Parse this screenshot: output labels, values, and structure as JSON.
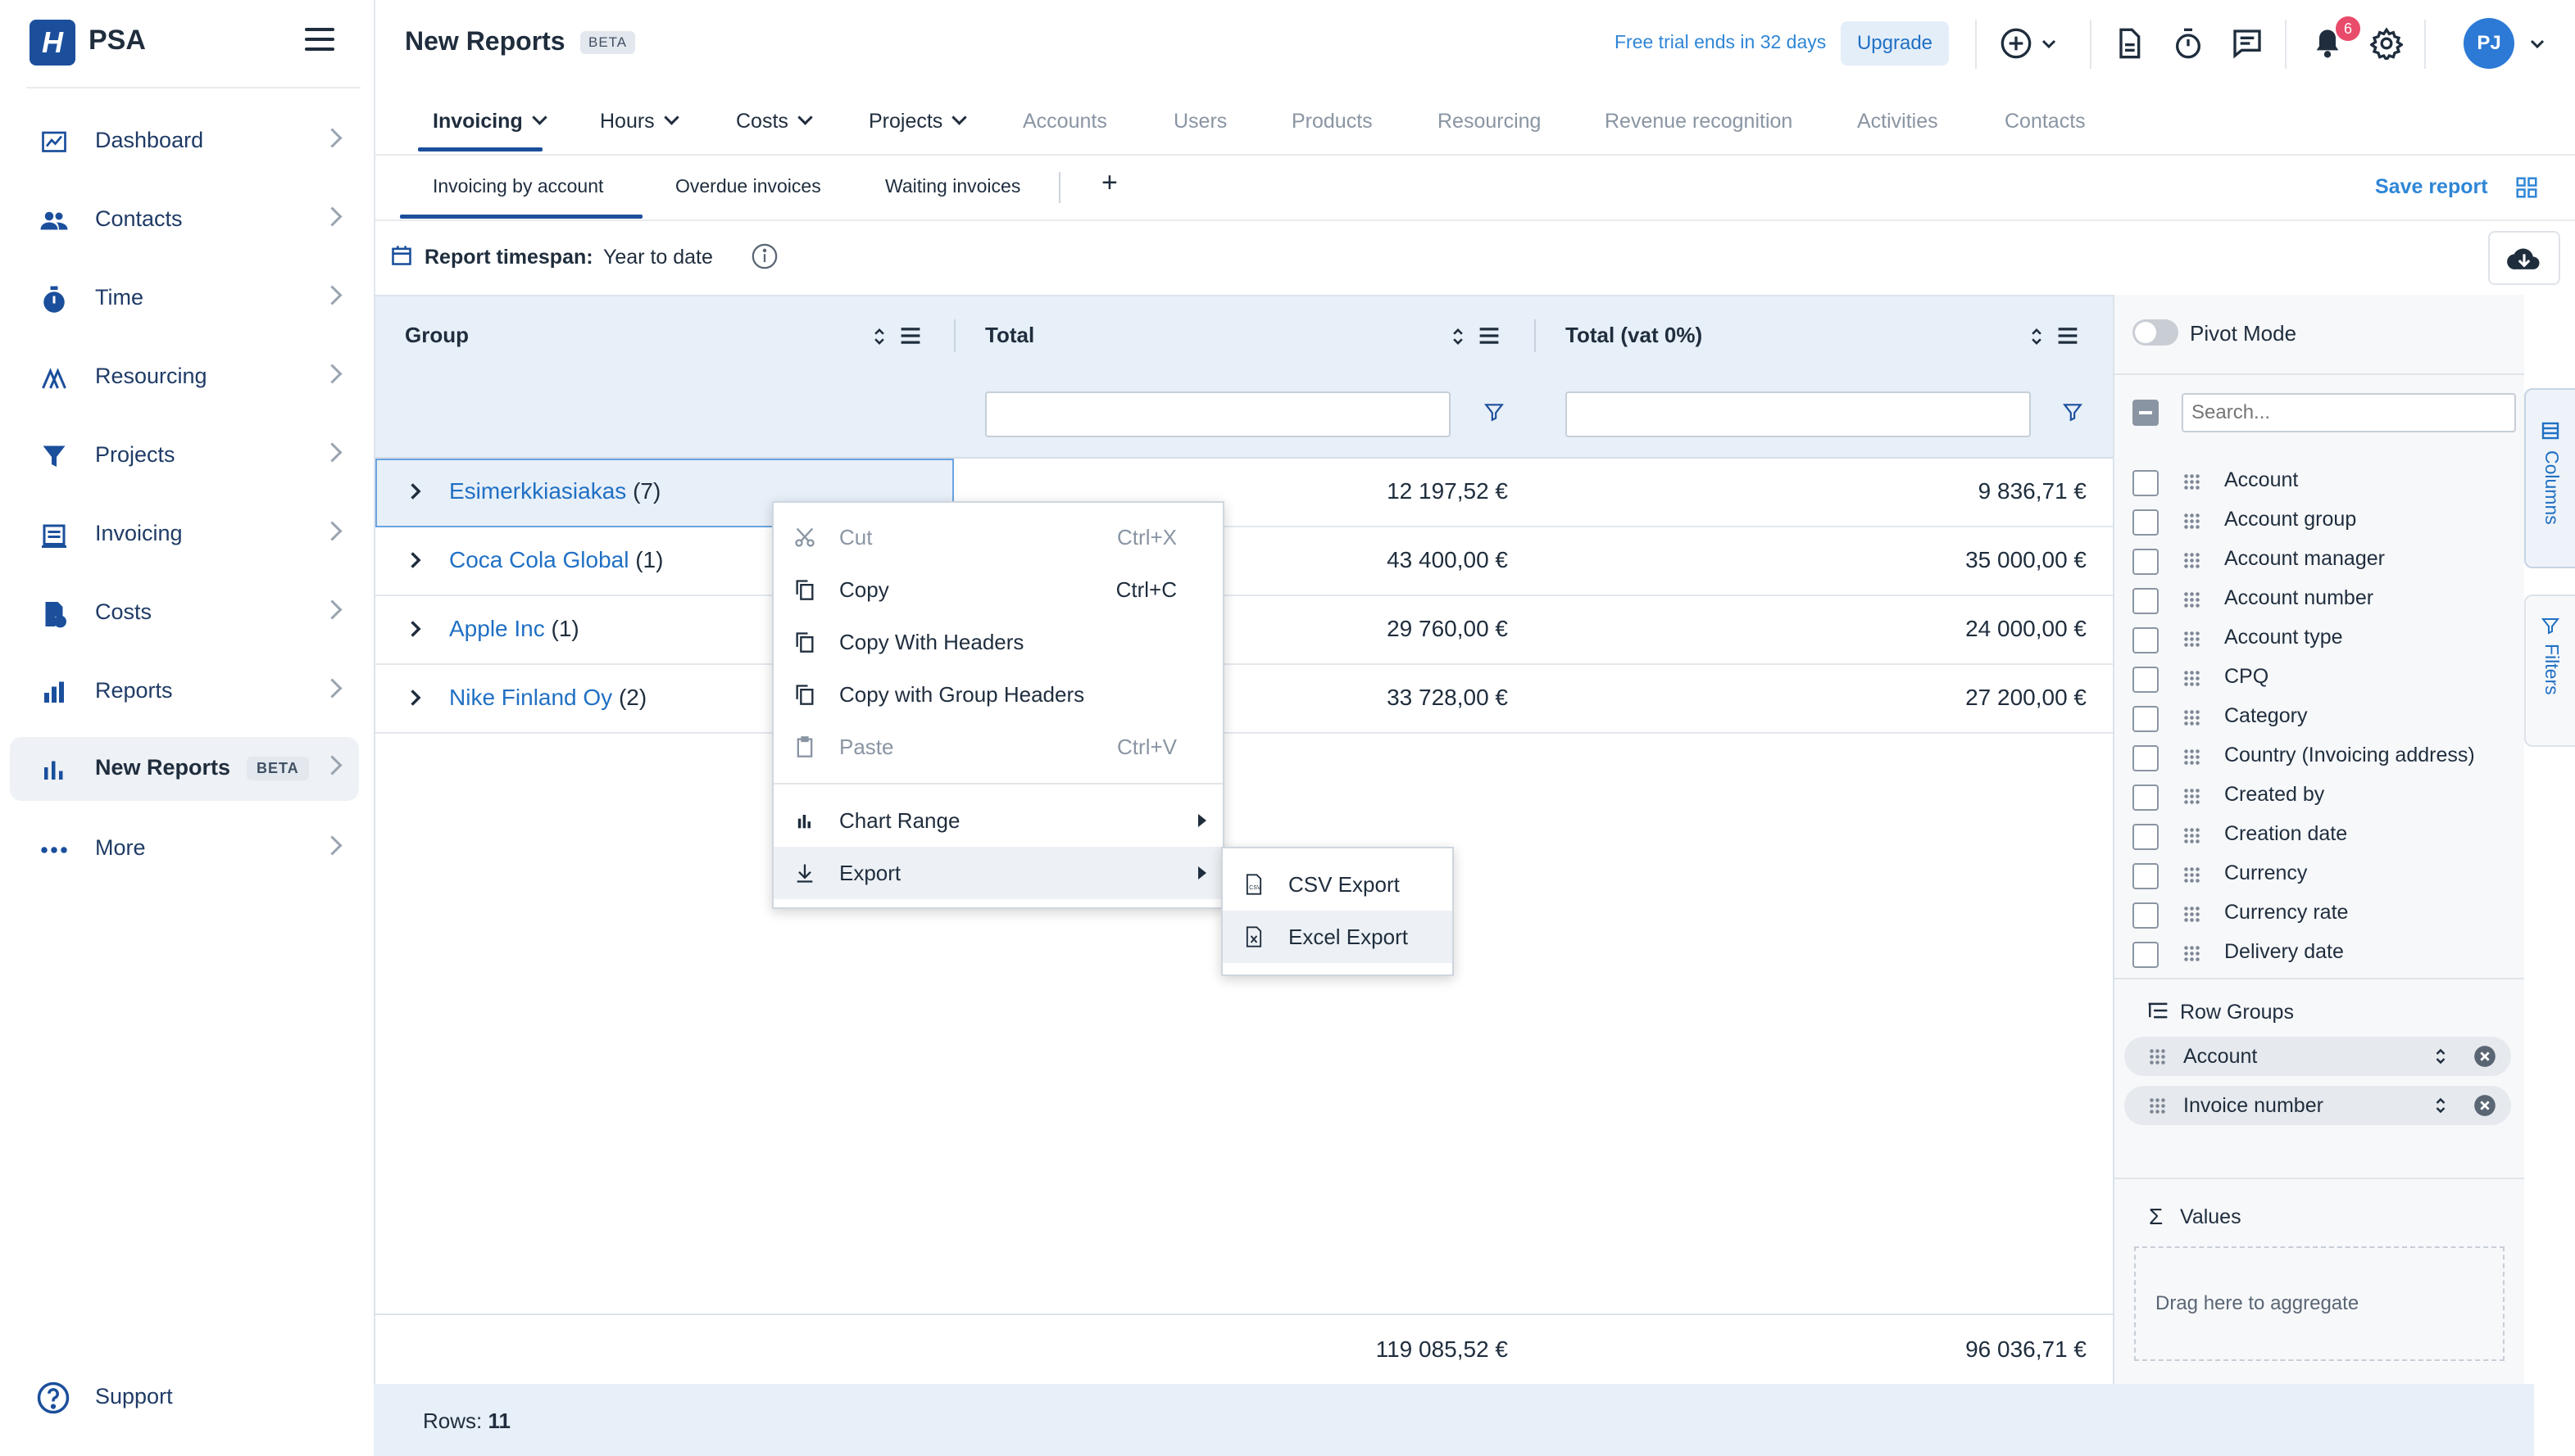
{
  "app": {
    "brand": "PSA",
    "logo_letter": "H"
  },
  "sidebar": {
    "items": [
      {
        "label": "Dashboard",
        "icon": "dashboard-icon"
      },
      {
        "label": "Contacts",
        "icon": "contacts-icon"
      },
      {
        "label": "Time",
        "icon": "stopwatch-icon"
      },
      {
        "label": "Resourcing",
        "icon": "resourcing-icon"
      },
      {
        "label": "Projects",
        "icon": "funnel-icon"
      },
      {
        "label": "Invoicing",
        "icon": "invoice-icon"
      },
      {
        "label": "Costs",
        "icon": "costs-icon"
      },
      {
        "label": "Reports",
        "icon": "bar-chart-icon"
      },
      {
        "label": "New Reports",
        "icon": "bar-chart-icon",
        "badge": "BETA",
        "active": true
      },
      {
        "label": "More",
        "icon": "more-dots-icon"
      }
    ],
    "support": "Support"
  },
  "header": {
    "title": "New Reports",
    "title_badge": "BETA",
    "trial_text": "Free trial ends in 32 days",
    "upgrade": "Upgrade",
    "notifications_count": "6",
    "avatar_initials": "PJ"
  },
  "module_tabs": [
    {
      "label": "Invoicing",
      "dropdown": true,
      "active": true
    },
    {
      "label": "Hours",
      "dropdown": true
    },
    {
      "label": "Costs",
      "dropdown": true
    },
    {
      "label": "Projects",
      "dropdown": true
    },
    {
      "label": "Accounts",
      "disabled": true
    },
    {
      "label": "Users",
      "disabled": true
    },
    {
      "label": "Products",
      "disabled": true
    },
    {
      "label": "Resourcing",
      "disabled": true
    },
    {
      "label": "Revenue recognition",
      "disabled": true
    },
    {
      "label": "Activities",
      "disabled": true
    },
    {
      "label": "Contacts",
      "disabled": true
    }
  ],
  "report_tabs": [
    {
      "label": "Invoicing by account",
      "active": true
    },
    {
      "label": "Overdue invoices"
    },
    {
      "label": "Waiting invoices"
    }
  ],
  "add_tab": "+",
  "save_report": "Save report",
  "timespan": {
    "label": "Report timespan:",
    "value": "Year to date"
  },
  "grid": {
    "columns": [
      "Group",
      "Total",
      "Total (vat 0%)"
    ],
    "rows": [
      {
        "group": "Esimerkkiasiakas",
        "count": "(7)",
        "total": "12 197,52 €",
        "total_vat0": "9 836,71 €"
      },
      {
        "group": "Coca Cola Global",
        "count": "(1)",
        "total": "43 400,00 €",
        "total_vat0": "35 000,00 €"
      },
      {
        "group": "Apple Inc",
        "count": "(1)",
        "total": "29 760,00 €",
        "total_vat0": "24 000,00 €"
      },
      {
        "group": "Nike Finland Oy",
        "count": "(2)",
        "total": "33 728,00 €",
        "total_vat0": "27 200,00 €"
      }
    ],
    "totals": {
      "total": "119 085,52 €",
      "total_vat0": "96 036,71 €"
    },
    "rows_label": "Rows:",
    "rows_count": "11"
  },
  "context_menu": {
    "items": [
      {
        "label": "Cut",
        "shortcut": "Ctrl+X",
        "icon": "scissors-icon",
        "disabled": true
      },
      {
        "label": "Copy",
        "shortcut": "Ctrl+C",
        "icon": "copy-icon"
      },
      {
        "label": "Copy With Headers",
        "icon": "copy-icon"
      },
      {
        "label": "Copy with Group Headers",
        "icon": "copy-icon"
      },
      {
        "label": "Paste",
        "shortcut": "Ctrl+V",
        "icon": "clipboard-icon",
        "disabled": true
      },
      {
        "label": "Chart Range",
        "icon": "chart-icon",
        "submenu": true
      },
      {
        "label": "Export",
        "icon": "download-icon",
        "submenu": true,
        "highlighted": true
      }
    ],
    "export_submenu": [
      {
        "label": "CSV Export",
        "icon": "csv-file-icon"
      },
      {
        "label": "Excel Export",
        "icon": "excel-file-icon",
        "highlighted": true
      }
    ]
  },
  "side_panel": {
    "pivot_mode": "Pivot Mode",
    "search_placeholder": "Search...",
    "columns": [
      "Account",
      "Account group",
      "Account manager",
      "Account number",
      "Account type",
      "CPQ",
      "Category",
      "Country (Invoicing address)",
      "Created by",
      "Creation date",
      "Currency",
      "Currency rate",
      "Delivery date"
    ],
    "row_groups_title": "Row Groups",
    "row_groups": [
      "Account",
      "Invoice number"
    ],
    "values_title": "Values",
    "values_placeholder": "Drag here to aggregate",
    "tabs": [
      "Columns",
      "Filters"
    ]
  },
  "colors": {
    "primary": "#1b4f9c",
    "link": "#2070c4",
    "header_bg": "#e7eff8"
  }
}
